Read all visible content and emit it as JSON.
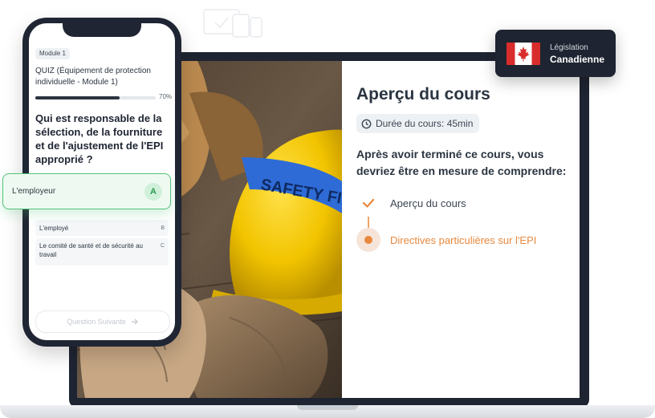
{
  "header": {
    "caption_line1": "",
    "caption_line2": ""
  },
  "badge": {
    "line1": "Législation",
    "line2": "Canadienne"
  },
  "course": {
    "title": "Aperçu du cours",
    "duration": "Durée du cours: 45min",
    "intro": "Après avoir terminé ce cours, vous devriez être en mesure de comprendre:",
    "steps": [
      {
        "label": "Aperçu du cours",
        "status": "done"
      },
      {
        "label": "Directives particulières sur l'EPI",
        "status": "active"
      }
    ]
  },
  "photo": {
    "helmet_text": "SAFETY FIRST"
  },
  "phone": {
    "module": "Module 1",
    "quiz_title": "QUIZ (Équipement de protection individuelle - Module 1)",
    "progress": 70,
    "progress_label": "70%",
    "question": "Qui est responsable de la sélection, de la fourniture et de l'ajustement de l'EPI approprié ?",
    "options": [
      {
        "text": "L'employeur",
        "letter": "A"
      },
      {
        "text": "L'employé",
        "letter": "B"
      },
      {
        "text": "Le comité de santé et de sécurité au travail",
        "letter": "C"
      }
    ],
    "next_button": "Question Suivante"
  },
  "colors": {
    "dark": "#1e2431",
    "accent_orange": "#e8893f",
    "selected_green": "#54c27a",
    "flag_red": "#d92c2c"
  }
}
